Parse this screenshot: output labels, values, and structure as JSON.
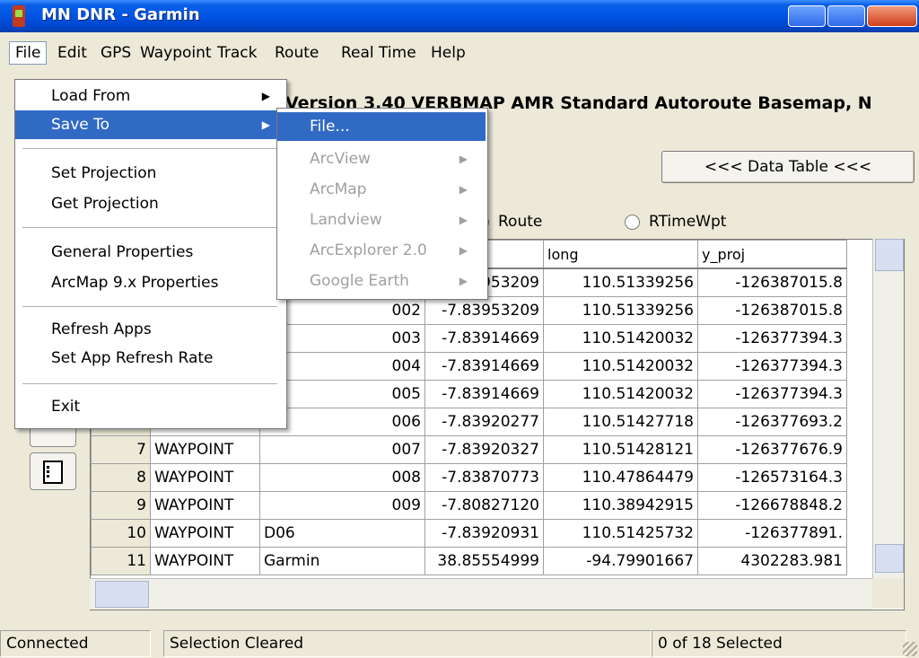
{
  "window": {
    "title": "MN DNR - Garmin"
  },
  "menubar": [
    "File",
    "Edit",
    "GPS",
    "Waypoint",
    "Track",
    "Route",
    "Real Time",
    "Help"
  ],
  "map_info": "Version 3.40 VERBMAP AMR Standard Autoroute Basemap, N",
  "data_table_button": "<<< Data Table <<<",
  "radios": [
    {
      "label": "Route",
      "checked": false
    },
    {
      "label": "RTimeWpt",
      "checked": false
    }
  ],
  "file_menu": {
    "items": [
      {
        "label": "Load From",
        "submenu": true
      },
      {
        "label": "Save To",
        "submenu": true,
        "selected": true
      },
      {
        "label": "Set Projection"
      },
      {
        "label": "Get Projection"
      },
      {
        "label": "General Properties"
      },
      {
        "label": "ArcMap 9.x Properties"
      },
      {
        "label": "Refresh Apps"
      },
      {
        "label": "Set App Refresh Rate"
      },
      {
        "label": "Exit"
      }
    ]
  },
  "save_to_menu": {
    "items": [
      {
        "label": "File...",
        "selected": true,
        "enabled": true
      },
      {
        "label": "ArcView",
        "submenu": true,
        "enabled": false
      },
      {
        "label": "ArcMap",
        "submenu": true,
        "enabled": false
      },
      {
        "label": "Landview",
        "submenu": true,
        "enabled": false
      },
      {
        "label": "ArcExplorer 2.0",
        "submenu": true,
        "enabled": false
      },
      {
        "label": "Google Earth",
        "submenu": true,
        "enabled": false
      }
    ]
  },
  "table": {
    "headers": [
      "",
      "",
      "",
      "",
      "long",
      "y_proj"
    ],
    "rows": [
      [
        "",
        "",
        "",
        "-7.83953209",
        "110.51339256",
        "-126387015.8"
      ],
      [
        "",
        "",
        "002",
        "-7.83953209",
        "110.51339256",
        "-126387015.8"
      ],
      [
        "",
        "",
        "003",
        "-7.83914669",
        "110.51420032",
        "-126377394.3"
      ],
      [
        "",
        "",
        "004",
        "-7.83914669",
        "110.51420032",
        "-126377394.3"
      ],
      [
        "",
        "",
        "005",
        "-7.83914669",
        "110.51420032",
        "-126377394.3"
      ],
      [
        "6",
        "WAYPOINT",
        "006",
        "-7.83920277",
        "110.51427718",
        "-126377693.2"
      ],
      [
        "7",
        "WAYPOINT",
        "007",
        "-7.83920327",
        "110.51428121",
        "-126377676.9"
      ],
      [
        "8",
        "WAYPOINT",
        "008",
        "-7.83870773",
        "110.47864479",
        "-126573164.3"
      ],
      [
        "9",
        "WAYPOINT",
        "009",
        "-7.80827120",
        "110.38942915",
        "-126678848.2"
      ],
      [
        "10",
        "WAYPOINT",
        "D06",
        "-7.83920931",
        "110.51425732",
        "-126377891."
      ],
      [
        "11",
        "WAYPOINT",
        "Garmin",
        "38.85554999",
        "-94.79901667",
        "4302283.981"
      ]
    ]
  },
  "status": {
    "connection": "Connected",
    "selection": "Selection Cleared",
    "count": "0 of 18 Selected"
  }
}
